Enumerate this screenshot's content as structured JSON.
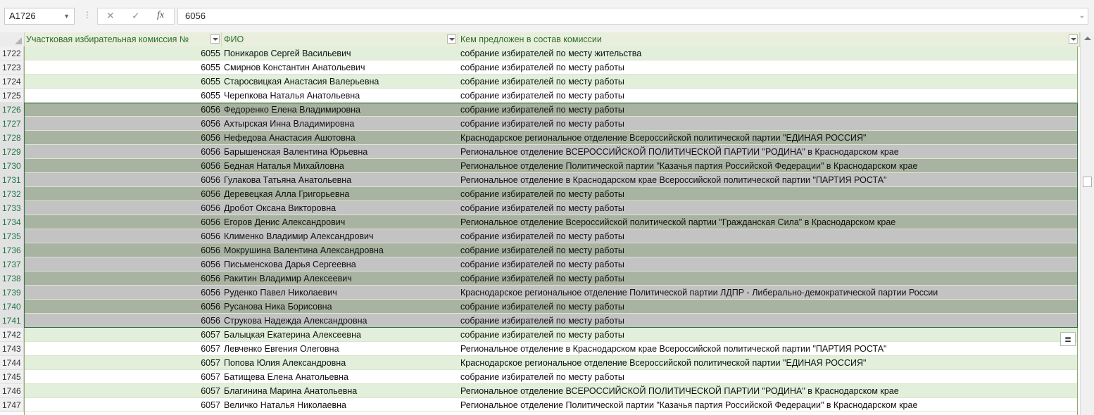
{
  "formula_bar": {
    "name_box": "A1726",
    "cancel_icon": "✕",
    "enter_icon": "✓",
    "fx_label": "fx",
    "value": "6056"
  },
  "headers": {
    "col_a": "Участковая избирательная комиссия №",
    "col_b": "ФИО",
    "col_c": "Кем предложен в состав комиссии"
  },
  "rows": [
    {
      "n": "1722",
      "a": "6055",
      "b": "Поникаров Сергей Васильевич",
      "c": "собрание избирателей по месту жительства"
    },
    {
      "n": "1723",
      "a": "6055",
      "b": "Смирнов Константин Анатольевич",
      "c": "собрание избирателей по месту работы"
    },
    {
      "n": "1724",
      "a": "6055",
      "b": "Старосвицкая Анастасия Валерьевна",
      "c": "собрание избирателей по месту работы"
    },
    {
      "n": "1725",
      "a": "6055",
      "b": "Черепкова Наталья Анатольевна",
      "c": "собрание избирателей по месту работы"
    },
    {
      "n": "1726",
      "a": "6056",
      "b": "Федоренко Елена Владимировна",
      "c": "собрание избирателей по месту работы"
    },
    {
      "n": "1727",
      "a": "6056",
      "b": "Ахтырская Инна Владимировна",
      "c": "собрание избирателей по месту работы"
    },
    {
      "n": "1728",
      "a": "6056",
      "b": "Нефедова Анастасия Ашотовна",
      "c": "Краснодарское региональное отделение Всероссийской политической партии \"ЕДИНАЯ РОССИЯ\""
    },
    {
      "n": "1729",
      "a": "6056",
      "b": "Барышенская Валентина Юрьевна",
      "c": "Региональное отделение ВСЕРОССИЙСКОЙ ПОЛИТИЧЕСКОЙ ПАРТИИ \"РОДИНА\" в Краснодарском крае"
    },
    {
      "n": "1730",
      "a": "6056",
      "b": "Бедная Наталья Михайловна",
      "c": "Региональное отделение Политической партии \"Казачья партия Российской Федерации\" в Краснодарском крае"
    },
    {
      "n": "1731",
      "a": "6056",
      "b": "Гулакова Татьяна Анатольевна",
      "c": "Региональное отделение в Краснодарском крае Всероссийской политической партии \"ПАРТИЯ РОСТА\""
    },
    {
      "n": "1732",
      "a": "6056",
      "b": "Деревецкая Алла Григорьевна",
      "c": "собрание избирателей по месту работы"
    },
    {
      "n": "1733",
      "a": "6056",
      "b": "Дробот Оксана Викторовна",
      "c": "собрание избирателей по месту работы"
    },
    {
      "n": "1734",
      "a": "6056",
      "b": "Егоров Денис Александрович",
      "c": "Региональное отделение Всероссийской политической партии \"Гражданская Сила\" в Краснодарском крае"
    },
    {
      "n": "1735",
      "a": "6056",
      "b": "Клименко Владимир Александрович",
      "c": "собрание избирателей по месту работы"
    },
    {
      "n": "1736",
      "a": "6056",
      "b": "Мокрушина Валентина Александровна",
      "c": "собрание избирателей по месту работы"
    },
    {
      "n": "1737",
      "a": "6056",
      "b": "Письменскова Дарья Сергеевна",
      "c": "собрание избирателей по месту работы"
    },
    {
      "n": "1738",
      "a": "6056",
      "b": "Ракитин Владимир Алексеевич",
      "c": "собрание избирателей по месту работы"
    },
    {
      "n": "1739",
      "a": "6056",
      "b": "Руденко Павел Николаевич",
      "c": "Краснодарское региональное отделение Политической партии ЛДПР - Либерально-демократической партии России"
    },
    {
      "n": "1740",
      "a": "6056",
      "b": "Русанова Ника Борисовна",
      "c": "собрание избирателей по месту работы"
    },
    {
      "n": "1741",
      "a": "6056",
      "b": "Струкова Надежда Александровна",
      "c": "собрание избирателей по месту работы"
    },
    {
      "n": "1742",
      "a": "6057",
      "b": "Балыцкая Екатерина Алексеевна",
      "c": "собрание избирателей по месту работы"
    },
    {
      "n": "1743",
      "a": "6057",
      "b": "Левченко Евгения Олеговна",
      "c": "Региональное отделение в Краснодарском крае Всероссийской политической партии \"ПАРТИЯ РОСТА\""
    },
    {
      "n": "1744",
      "a": "6057",
      "b": "Попова Юлия Александровна",
      "c": "Краснодарское региональное отделение Всероссийской политической партии \"ЕДИНАЯ РОССИЯ\""
    },
    {
      "n": "1745",
      "a": "6057",
      "b": "Батищева Елена Анатольевна",
      "c": "собрание избирателей по месту работы"
    },
    {
      "n": "1746",
      "a": "6057",
      "b": "Благинина Марина Анатольевна",
      "c": "Региональное отделение ВСЕРОССИЙСКОЙ ПОЛИТИЧЕСКОЙ ПАРТИИ \"РОДИНА\" в Краснодарском крае"
    },
    {
      "n": "1747",
      "a": "6057",
      "b": "Величко Наталья Николаевна",
      "c": "Региональное отделение Политической партии \"Казачья партия Российской Федерации\" в Краснодарском крае"
    }
  ],
  "selection": {
    "first_row": "1726",
    "last_row": "1741"
  },
  "colors": {
    "band_green": "#e2efda",
    "selected_green": "#a9b3a1",
    "selected_white": "#c3c3c3",
    "accent": "#217346"
  },
  "icons": {
    "quick_analysis": "quick-analysis-icon"
  }
}
